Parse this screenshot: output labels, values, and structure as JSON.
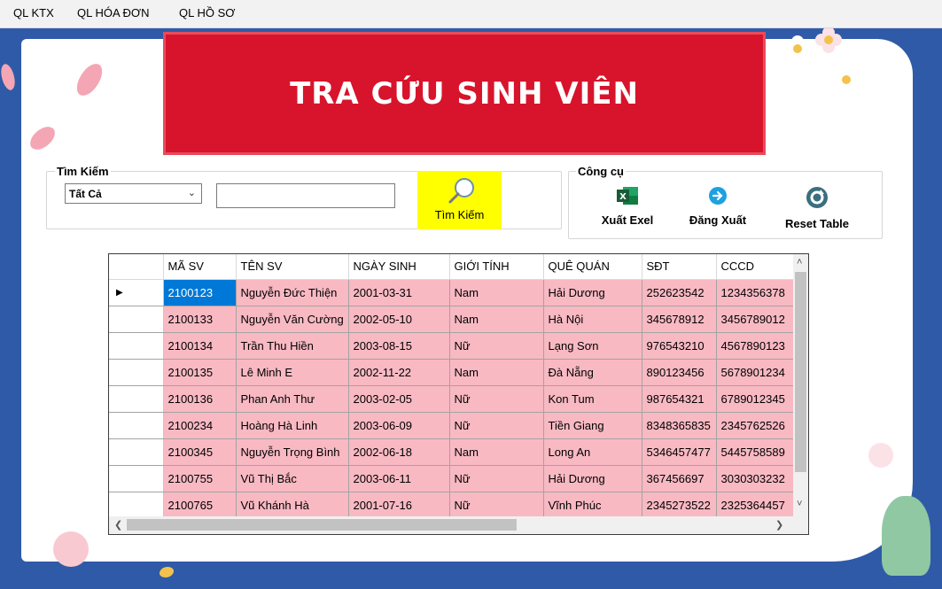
{
  "menu": {
    "items": [
      "QL KTX",
      "QL HÓA ĐƠN",
      "QL HỒ SƠ"
    ]
  },
  "banner": {
    "title": "TRA CỨU SINH VIÊN"
  },
  "search": {
    "group_label": "Tìm Kiếm",
    "filter_value": "Tất Cả",
    "input_value": "",
    "button_label": "Tìm Kiếm"
  },
  "tools": {
    "group_label": "Công cụ",
    "export_label": "Xuất Exel",
    "logout_label": "Đăng Xuất",
    "reset_label": "Reset Table"
  },
  "grid": {
    "columns": [
      "MÃ SV",
      "TÊN SV",
      "NGÀY SINH",
      "GIỚI TÍNH",
      "QUÊ QUÁN",
      "SĐT",
      "CCCD"
    ],
    "rows": [
      [
        "2100123",
        "Nguyễn Đức Thiện",
        "2001-03-31",
        "Nam",
        "Hải Dương",
        "252623542",
        "1234356378"
      ],
      [
        "2100133",
        "Nguyễn Văn Cường",
        "2002-05-10",
        "Nam",
        "Hà Nội",
        "345678912",
        "3456789012"
      ],
      [
        "2100134",
        "Trần Thu Hiền",
        "2003-08-15",
        "Nữ",
        "Lạng Sơn",
        "976543210",
        "4567890123"
      ],
      [
        "2100135",
        "Lê Minh E",
        "2002-11-22",
        "Nam",
        "Đà Nẵng",
        "890123456",
        "5678901234"
      ],
      [
        "2100136",
        "Phan Anh Thư",
        "2003-02-05",
        "Nữ",
        "Kon Tum",
        "987654321",
        "6789012345"
      ],
      [
        "2100234",
        "Hoàng Hà Linh",
        "2003-06-09",
        "Nữ",
        "Tiền Giang",
        "8348365835",
        "2345762526"
      ],
      [
        "2100345",
        "Nguyễn Trọng Bình",
        "2002-06-18",
        "Nam",
        "Long An",
        "5346457477",
        "5445758589"
      ],
      [
        "2100755",
        "Vũ Thị Bắc",
        "2003-06-11",
        "Nữ",
        "Hải Dương",
        "367456697",
        "3030303232"
      ],
      [
        "2100765",
        "Vũ Khánh Hà",
        "2001-07-16",
        "Nữ",
        "Vĩnh Phúc",
        "2345273522",
        "2325364457"
      ]
    ]
  },
  "colors": {
    "banner": "#d7142c",
    "search_button": "#ffff00",
    "row_bg": "#f8b9c3",
    "selected_cell": "#0078d7",
    "background": "#2f5aa8"
  }
}
